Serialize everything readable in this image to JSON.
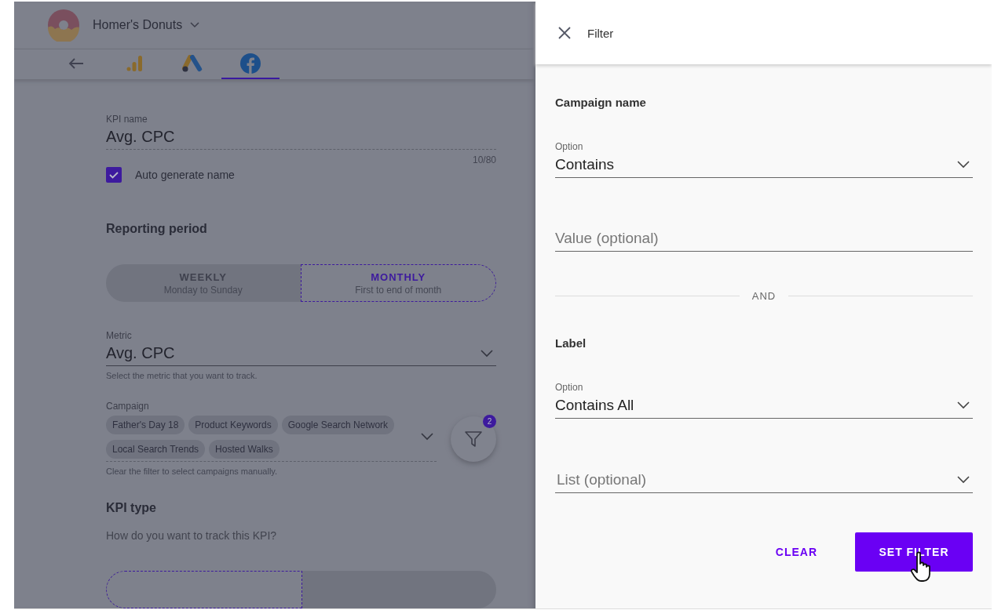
{
  "header": {
    "title": "Homer's Donuts"
  },
  "tabs": [
    {
      "kind": "back",
      "selected": false
    },
    {
      "kind": "analytics",
      "selected": false
    },
    {
      "kind": "ads",
      "selected": false
    },
    {
      "kind": "facebook",
      "selected": true
    }
  ],
  "kpi_name": {
    "label": "KPI name",
    "value": "Avg. CPC",
    "counter": "10/80"
  },
  "auto_generate": {
    "label": "Auto generate name",
    "checked": true
  },
  "reporting_period": {
    "heading": "Reporting period",
    "options": [
      {
        "label": "WEEKLY",
        "sub": "Monday to Sunday",
        "selected": false
      },
      {
        "label": "MONTHLY",
        "sub": "First to end of month",
        "selected": true
      }
    ]
  },
  "metric": {
    "label": "Metric",
    "value": "Avg. CPC",
    "helper": "Select the metric that you want to track."
  },
  "campaign": {
    "label": "Campaign",
    "chips": [
      "Father's Day 18",
      "Product Keywords",
      "Google Search Network",
      "Local Search Trends",
      "Hosted Walks"
    ],
    "helper": "Clear the filter to select campaigns manually.",
    "filter_badge": "2"
  },
  "kpi_type": {
    "heading": "KPI type",
    "question": "How do you want to track this KPI?",
    "options": [
      {
        "selected": true
      },
      {
        "selected": false
      }
    ]
  },
  "filter_panel": {
    "title": "Filter",
    "sections": [
      {
        "heading": "Campaign name",
        "option_label": "Option",
        "option_value": "Contains",
        "input_placeholder": "Value (optional)",
        "kind": "text"
      },
      {
        "heading": "Label",
        "option_label": "Option",
        "option_value": "Contains All",
        "input_placeholder": "List (optional)",
        "kind": "select"
      }
    ],
    "divider": "AND",
    "buttons": {
      "clear": "CLEAR",
      "submit": "SET FILTER"
    }
  }
}
